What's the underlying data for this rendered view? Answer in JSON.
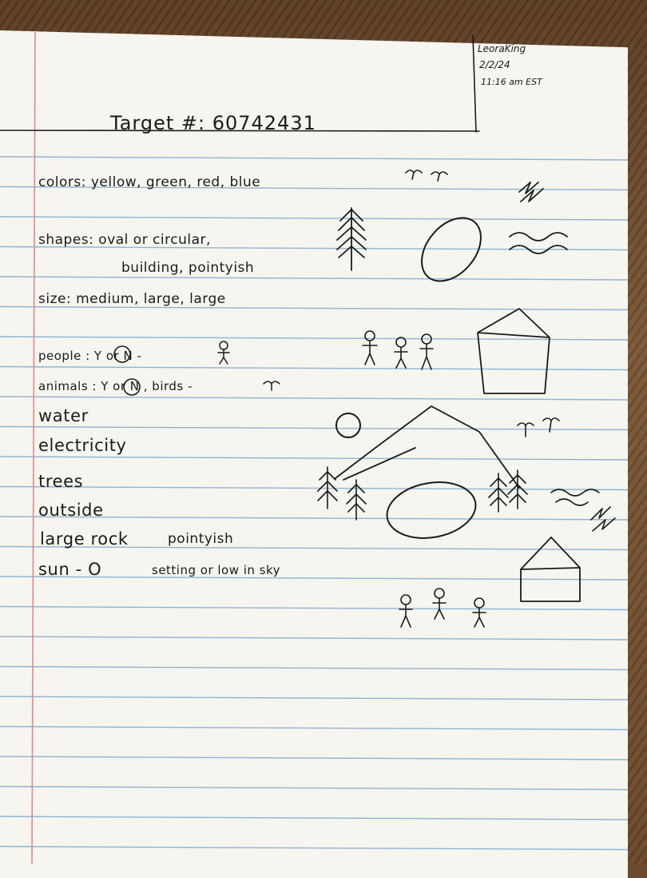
{
  "header": {
    "name": "LeoraKing",
    "date": "2/2/24",
    "time": "11:16 am EST",
    "title": "Target #: 60742431"
  },
  "notes": {
    "colors": "colors: yellow, green, red, blue",
    "shapes_1": "shapes: oval or circular,",
    "shapes_2": "building, pointyish",
    "size": "size: medium, large, large",
    "people": "people : Y or N - ",
    "animals": "animals : Y or N , birds - ",
    "water": "water",
    "electricity": "electricity",
    "trees": "trees",
    "outside": "outside",
    "rock": "large rock",
    "rock_note": "pointyish",
    "sun": "sun - O",
    "sun_note": "setting or low in sky"
  },
  "colors": {
    "ink": "#1b1b1b",
    "rule_line": "#8fb4d6",
    "margin_line": "#e08a8a",
    "paper": "#f6f5ef"
  }
}
